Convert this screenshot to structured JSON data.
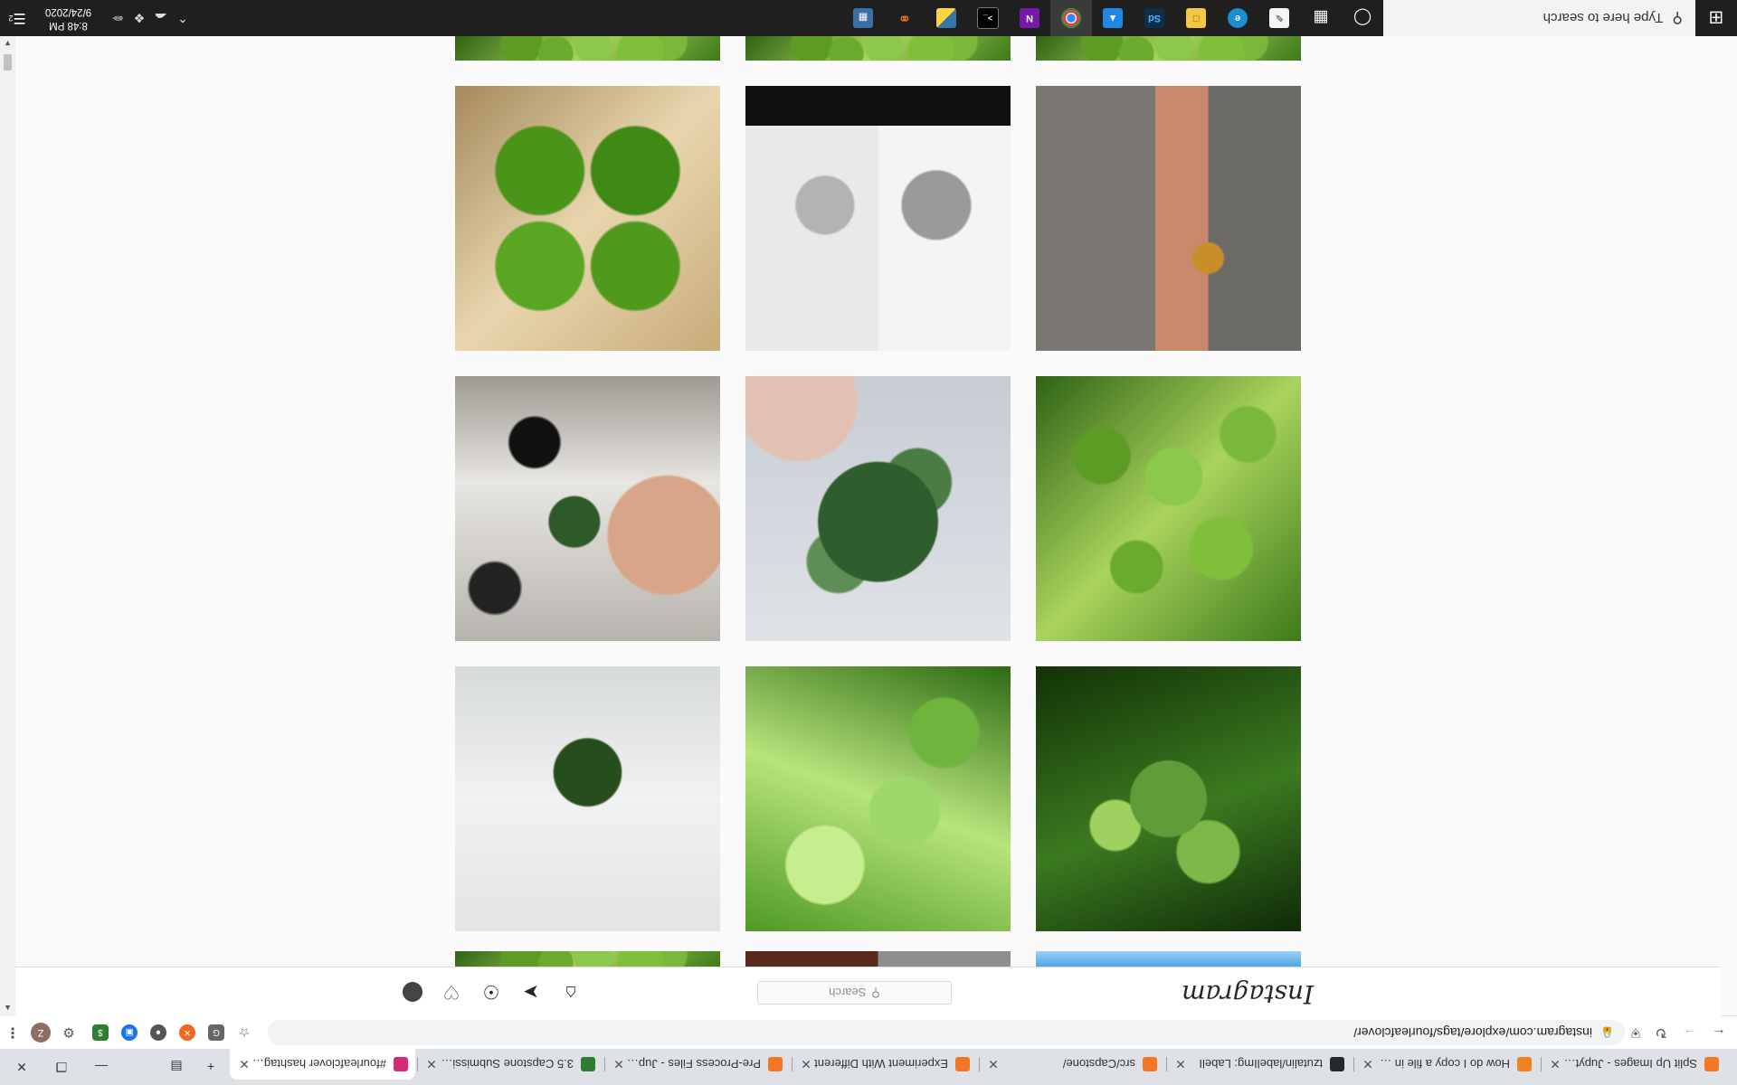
{
  "browser": {
    "tabs": [
      {
        "title": "Split Up Images - Jupyter N",
        "favicon": "jupyter-icon",
        "color": "#f37726"
      },
      {
        "title": "How do I copy a file in Pyth",
        "favicon": "stackoverflow-icon",
        "color": "#f48024"
      },
      {
        "title": "tzutalin/labelImg: LabelI",
        "favicon": "github-icon",
        "color": "#24292e"
      },
      {
        "title": "src/Capstone/",
        "favicon": "jupyter-icon",
        "color": "#f37726"
      },
      {
        "title": "Experiment With Different",
        "favicon": "jupyter-icon",
        "color": "#f37726"
      },
      {
        "title": "Pre-Process Files - Jupyter",
        "favicon": "jupyter-icon",
        "color": "#f37726"
      },
      {
        "title": "3.5 Capstone Submission - ",
        "favicon": "course-icon",
        "color": "#2e7d32"
      },
      {
        "title": "#fourleafclover hashtag on",
        "favicon": "instagram-icon",
        "color": "#d62976"
      }
    ],
    "url": "instagram.com/explore/tags/fourleafclover/"
  },
  "instagram": {
    "logo": "Instagram",
    "search_placeholder": "Search",
    "grid_rows": [
      [
        "sky",
        "brownish",
        "leafy"
      ],
      [
        "darkclover",
        "brightclover",
        "napkin"
      ],
      [
        "leafy",
        "handbunch",
        "cathand"
      ],
      [
        "sweater",
        "sketch",
        "fourleaf"
      ],
      [
        "leafy",
        "leafy",
        "leafy"
      ]
    ]
  },
  "taskbar": {
    "search_placeholder": "Type here to search",
    "time": "8:48 PM",
    "date": "9/24/2020",
    "notification_count": "2"
  }
}
